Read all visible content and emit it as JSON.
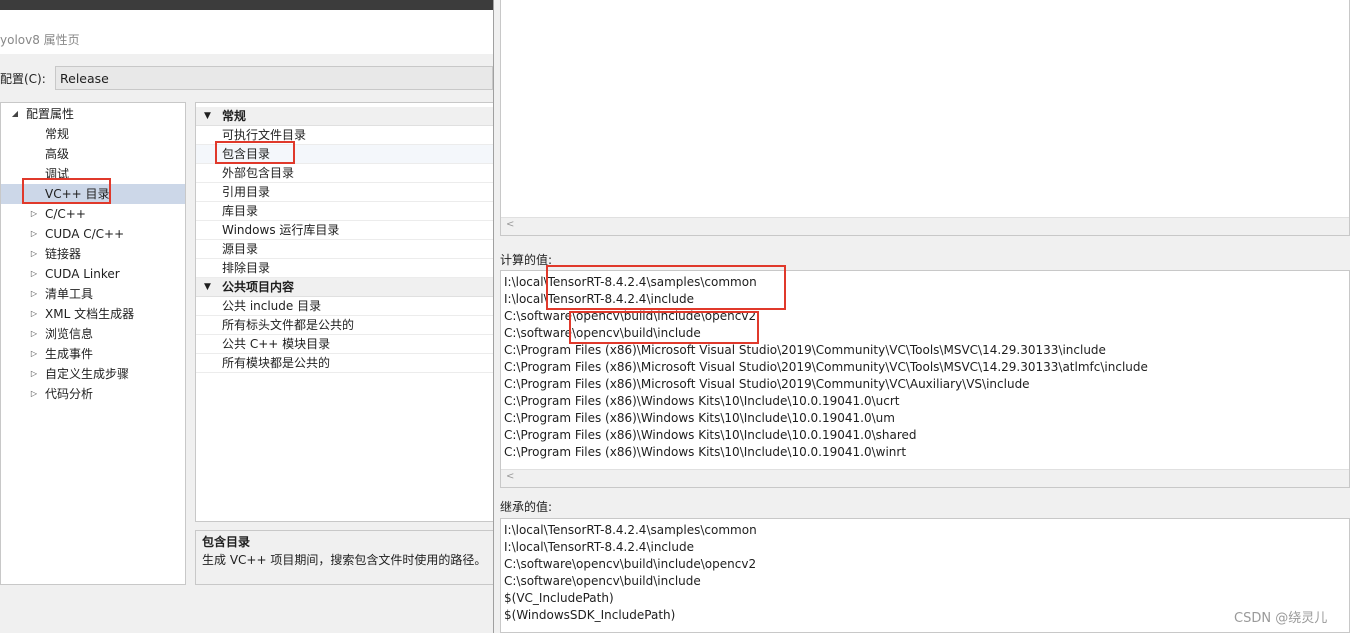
{
  "window": {
    "title": "yolov8 属性页"
  },
  "config": {
    "label": "配置(C):",
    "value": "Release"
  },
  "tree": {
    "root": "配置属性",
    "items": [
      {
        "label": "常规",
        "expandable": false
      },
      {
        "label": "高级",
        "expandable": false
      },
      {
        "label": "调试",
        "expandable": false
      },
      {
        "label": "VC++ 目录",
        "expandable": false,
        "selected": true
      },
      {
        "label": "C/C++",
        "expandable": true
      },
      {
        "label": "CUDA C/C++",
        "expandable": true
      },
      {
        "label": "链接器",
        "expandable": true
      },
      {
        "label": "CUDA Linker",
        "expandable": true
      },
      {
        "label": "清单工具",
        "expandable": true
      },
      {
        "label": "XML 文档生成器",
        "expandable": true
      },
      {
        "label": "浏览信息",
        "expandable": true
      },
      {
        "label": "生成事件",
        "expandable": true
      },
      {
        "label": "自定义生成步骤",
        "expandable": true
      },
      {
        "label": "代码分析",
        "expandable": true
      }
    ]
  },
  "grid": {
    "categories": [
      {
        "name": "常规",
        "rows": [
          "可执行文件目录",
          "包含目录",
          "外部包含目录",
          "引用目录",
          "库目录",
          "Windows 运行库目录",
          "源目录",
          "排除目录"
        ]
      },
      {
        "name": "公共项目内容",
        "rows": [
          "公共 include 目录",
          "所有标头文件都是公共的",
          "公共 C++ 模块目录",
          "所有模块都是公共的"
        ]
      }
    ]
  },
  "description": {
    "title": "包含目录",
    "text": "生成 VC++ 项目期间，搜索包含文件时使用的路径。"
  },
  "computed": {
    "label": "计算的值:",
    "lines": [
      "I:\\local\\TensorRT-8.4.2.4\\samples\\common",
      "I:\\local\\TensorRT-8.4.2.4\\include",
      "C:\\software\\opencv\\build\\include\\opencv2",
      "C:\\software\\opencv\\build\\include",
      "C:\\Program Files (x86)\\Microsoft Visual Studio\\2019\\Community\\VC\\Tools\\MSVC\\14.29.30133\\include",
      "C:\\Program Files (x86)\\Microsoft Visual Studio\\2019\\Community\\VC\\Tools\\MSVC\\14.29.30133\\atlmfc\\include",
      "C:\\Program Files (x86)\\Microsoft Visual Studio\\2019\\Community\\VC\\Auxiliary\\VS\\include",
      "C:\\Program Files (x86)\\Windows Kits\\10\\Include\\10.0.19041.0\\ucrt",
      "C:\\Program Files (x86)\\Windows Kits\\10\\Include\\10.0.19041.0\\um",
      "C:\\Program Files (x86)\\Windows Kits\\10\\Include\\10.0.19041.0\\shared",
      "C:\\Program Files (x86)\\Windows Kits\\10\\Include\\10.0.19041.0\\winrt"
    ]
  },
  "inherited": {
    "label": "继承的值:",
    "lines": [
      "I:\\local\\TensorRT-8.4.2.4\\samples\\common",
      "I:\\local\\TensorRT-8.4.2.4\\include",
      "C:\\software\\opencv\\build\\include\\opencv2",
      "C:\\software\\opencv\\build\\include",
      "$(VC_IncludePath)",
      "$(WindowsSDK_IncludePath)"
    ]
  },
  "watermark": "CSDN @绕灵儿",
  "colors": {
    "selection": "#ccd7e8",
    "annotation": "#e0392b"
  }
}
